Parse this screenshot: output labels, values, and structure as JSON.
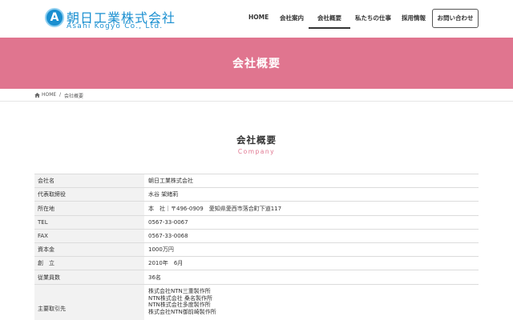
{
  "header": {
    "logo_letter": "A",
    "company_name": "朝日工業株式会社",
    "company_name_en": "Asahi Kogyo Co., Ltd.",
    "nav": [
      {
        "label": "HOME"
      },
      {
        "label": "会社案内"
      },
      {
        "label": "会社概要"
      },
      {
        "label": "私たちの仕事"
      },
      {
        "label": "採用情報"
      }
    ],
    "contact_label": "お問い合わせ",
    "active_nav": "会社概要"
  },
  "hero": {
    "title": "会社概要"
  },
  "breadcrumb": {
    "home": "HOME",
    "separator": "/",
    "current": "会社概要"
  },
  "section": {
    "title": "会社概要",
    "subtitle": "Company"
  },
  "table": {
    "rows": [
      {
        "label": "会社名",
        "value": "朝日工業株式会社"
      },
      {
        "label": "代表取締役",
        "value": "水谷 架緒莉"
      },
      {
        "label": "所在地",
        "value": "本　社｜〒496-0909　愛知県愛西市落合町下道117"
      },
      {
        "label": "TEL",
        "value": "0567-33-0067"
      },
      {
        "label": "FAX",
        "value": "0567-33-0068"
      },
      {
        "label": "資本金",
        "value": "1000万円"
      },
      {
        "label": "創　立",
        "value": "2010年　6月"
      },
      {
        "label": "従業員数",
        "value": "36名"
      },
      {
        "label": "主要取引先",
        "values": [
          "株式会社NTN三重製作所",
          "NTN株式会社 桑名製作所",
          "NTN株式会社多度製作所",
          "株式会社NTN御前崎製作所"
        ]
      }
    ]
  },
  "colors": {
    "brand_blue": "#1a8fd0",
    "accent_pink": "#e0758f",
    "label_bg": "#f2f2f2"
  }
}
